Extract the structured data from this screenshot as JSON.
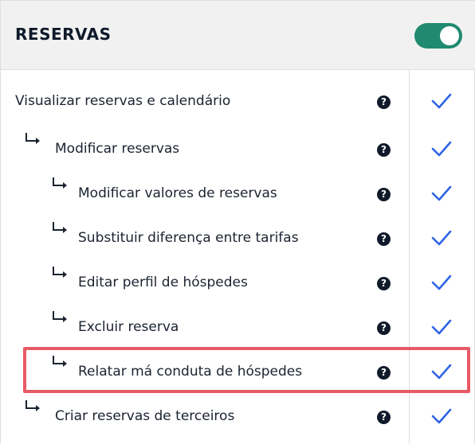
{
  "header": {
    "title": "RESERVAS",
    "toggle_on": true,
    "toggle_color": "#1f8a70"
  },
  "icons": {
    "help": "question-circle-icon",
    "check": "checkmark-icon",
    "sub": "sub-item-arrow-icon",
    "check_color": "#2f64e6"
  },
  "highlight_color": "#e85a66",
  "rows": [
    {
      "label": "Visualizar reservas e calendário",
      "help": "?",
      "checked": true
    },
    {
      "label": "Modificar reservas",
      "help": "?",
      "checked": true
    },
    {
      "label": "Modificar valores de reservas",
      "help": "?",
      "checked": true
    },
    {
      "label": "Substituir diferença entre tarifas",
      "help": "?",
      "checked": true
    },
    {
      "label": "Editar perfil de hóspedes",
      "help": "?",
      "checked": true
    },
    {
      "label": "Excluir reserva",
      "help": "?",
      "checked": true
    },
    {
      "label": "Relatar má conduta de hóspedes",
      "help": "?",
      "checked": true,
      "highlighted": true
    },
    {
      "label": "Criar reservas de terceiros",
      "help": "?",
      "checked": true
    }
  ]
}
